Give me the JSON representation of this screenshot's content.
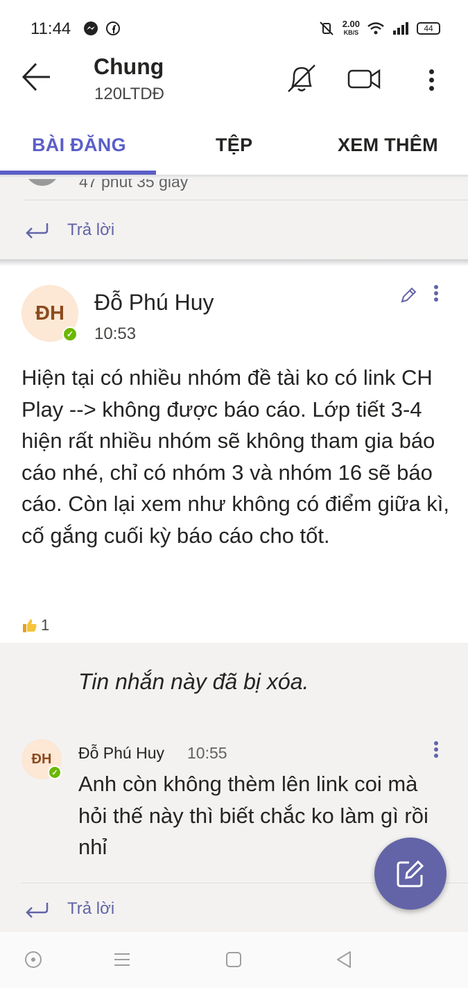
{
  "status_bar": {
    "time": "11:44",
    "speed": "2.00",
    "speed_unit": "KB/S",
    "battery": "44"
  },
  "header": {
    "title": "Chung",
    "subtitle": "120LTDĐ"
  },
  "tabs": [
    {
      "label": "BÀI ĐĂNG",
      "active": true
    },
    {
      "label": "TỆP",
      "active": false
    },
    {
      "label": "XEM THÊM",
      "active": false
    }
  ],
  "previous_thread": {
    "partial_text": "47 phút 35 giây",
    "reply_label": "Trả lời"
  },
  "post": {
    "avatar_initials": "ĐH",
    "author": "Đỗ Phú Huy",
    "time": "10:53",
    "body": "Hiện tại có nhiều nhóm đề tài ko có link CH Play --> không được báo cáo. Lớp tiết 3-4 hiện rất nhiều nhóm sẽ không tham gia báo cáo nhé, chỉ có nhóm 3 và nhóm 16 sẽ báo cáo. Còn lại xem như không có điểm giữa kì, cố gắng cuối kỳ báo cáo cho tốt.",
    "like_count": "1"
  },
  "replies": {
    "deleted_notice": "Tin nhắn này đã bị xóa.",
    "reply": {
      "avatar_initials": "ĐH",
      "author": "Đỗ Phú Huy",
      "time": "10:55",
      "body": "Anh còn không thèm lên link coi mà hỏi thế này thì biết chắc ko làm gì rồi nhỉ"
    },
    "reply_label": "Trả lời"
  },
  "colors": {
    "accent": "#5b5fc7",
    "fab": "#6264a7",
    "presence": "#6bb700",
    "avatar_bg": "#fde7d5",
    "thread_bg": "#f3f2f1"
  },
  "icons": [
    "back-arrow-icon",
    "bell-off-icon",
    "video-call-icon",
    "more-vertical-icon",
    "reply-icon",
    "pencil-icon",
    "thumbs-up-icon",
    "compose-icon"
  ]
}
